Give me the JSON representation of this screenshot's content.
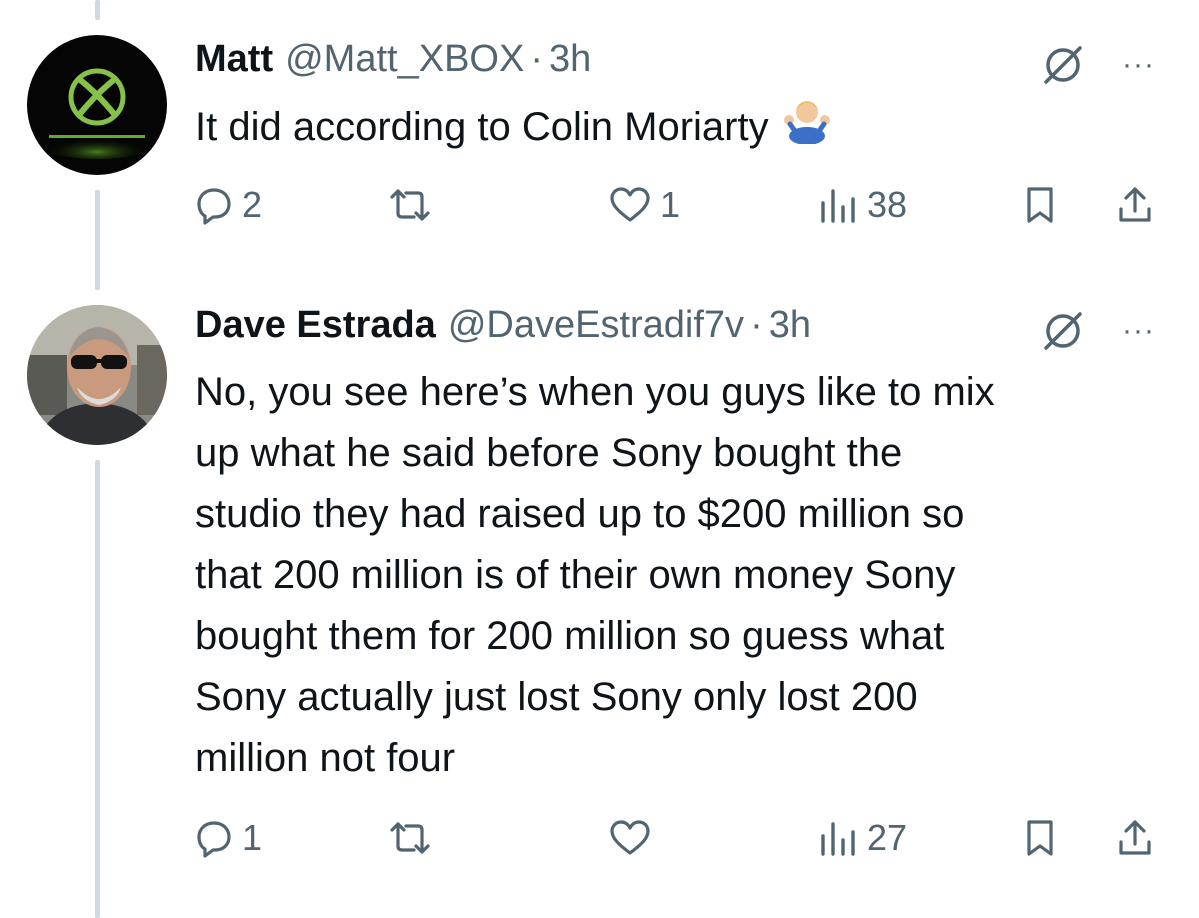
{
  "tweets": [
    {
      "name": "Matt",
      "handle": "@Matt_XBOX",
      "separator": "·",
      "time": "3h",
      "text": "It did according to Colin Moriarty",
      "emoji": "person-shrugging-emoji",
      "avatar": "xbox-logo-avatar",
      "actions": {
        "replies": "2",
        "retweets": "",
        "likes": "1",
        "views": "38"
      }
    },
    {
      "name": "Dave Estrada",
      "handle": "@DaveEstradif7v",
      "separator": "·",
      "time": "3h",
      "lines": [
        "No, you see here’s when you guys like to mix",
        "up what he said before Sony bought the",
        "studio they had raised up to $200 million so",
        "that 200 million is of their own money Sony",
        "bought them for 200 million so guess what",
        "Sony actually just lost Sony only lost 200",
        "million not four"
      ],
      "avatar": "man-with-sunglasses-avatar",
      "actions": {
        "replies": "1",
        "retweets": "",
        "likes": "",
        "views": "27"
      }
    }
  ],
  "more_label": "···",
  "colors": {
    "text": "#0f1419",
    "secondary": "#536471",
    "thread": "#cfd9de",
    "xbox_green": "#6cc04a"
  }
}
